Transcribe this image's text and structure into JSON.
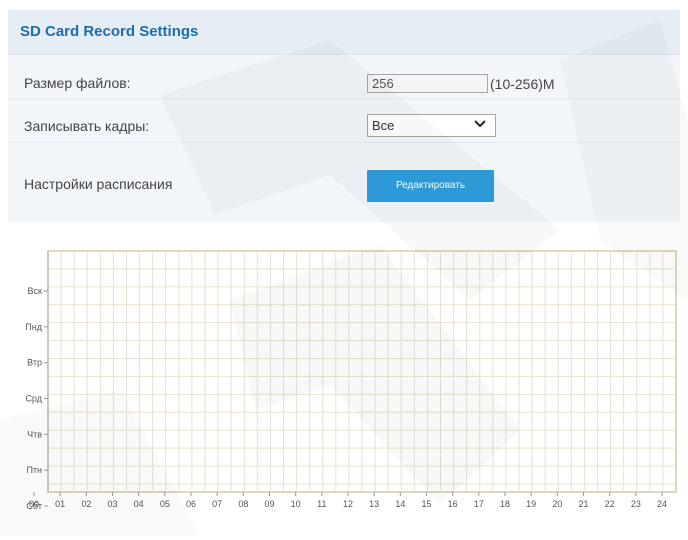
{
  "panel": {
    "title": "SD Card Record Settings",
    "file_size": {
      "label": "Размер файлов:",
      "value": "256",
      "range": "(10-256)M"
    },
    "record_frames": {
      "label": "Записывать кадры:",
      "selected": "Все"
    },
    "schedule": {
      "label": "Настройки расписания",
      "edit_button": "Редактировать"
    }
  },
  "schedule_chart": {
    "days": [
      "Вск",
      "Пнд",
      "Втр",
      "Срд",
      "Чтв",
      "Птн",
      "Сбт"
    ],
    "hours": [
      "00",
      "01",
      "02",
      "03",
      "04",
      "05",
      "06",
      "07",
      "08",
      "09",
      "10",
      "11",
      "12",
      "13",
      "14",
      "15",
      "16",
      "17",
      "18",
      "19",
      "20",
      "21",
      "22",
      "23",
      "24"
    ],
    "scheduled_blocks": []
  },
  "colors": {
    "accent": "#2f9fde",
    "title": "#1b6db0",
    "grid": "#e8e2cf"
  }
}
